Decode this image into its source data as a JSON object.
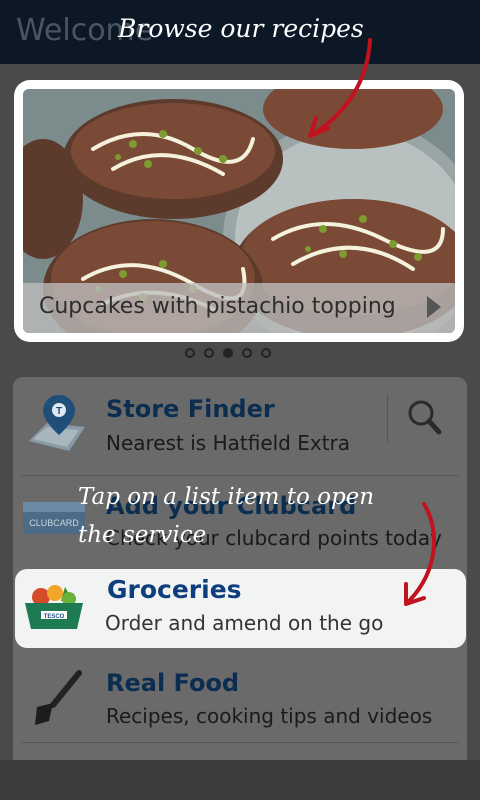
{
  "header": {
    "title": "Welcome"
  },
  "carousel": {
    "caption": "Cupcakes with pistachio topping",
    "dots_total": 5,
    "active_index": 2
  },
  "list": {
    "store_finder": {
      "title": "Store Finder",
      "sub_prefix": "Nearest",
      "sub_is": "is",
      "sub_store": "Hatfield Extra"
    },
    "clubcard": {
      "title": "Add your Clubcard",
      "sub": "Check your clubcard points today"
    },
    "groceries": {
      "title": "Groceries",
      "sub": "Order and amend on the go"
    },
    "real_food": {
      "title": "Real Food",
      "sub": "Recipes, cooking tips and videos"
    }
  },
  "annotations": {
    "browse": "Browse our recipes",
    "tap_line1": "Tap on a list item to open",
    "tap_line2": "the service"
  },
  "colors": {
    "accent": "#0d3f7d",
    "arrow": "#c1121f",
    "header": "#0c1826"
  }
}
